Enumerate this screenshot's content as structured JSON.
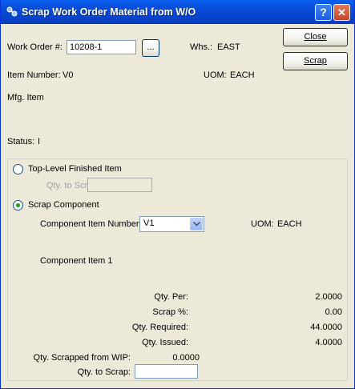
{
  "window": {
    "title": "Scrap Work Order Material from W/O",
    "help_label": "?",
    "close_label": "✕"
  },
  "header": {
    "work_order_label": "Work Order #:",
    "work_order_value": "10208-1",
    "lookup_label": "...",
    "whs_label": "Whs.:",
    "whs_value": "EAST",
    "item_number_label": "Item Number:",
    "item_number_value": "V0",
    "uom_label": "UOM:",
    "uom_value": "EACH",
    "description": "Mfg. Item",
    "status_label": "Status:",
    "status_value": "I"
  },
  "buttons": {
    "close_label": "Close",
    "scrap_label": "Scrap"
  },
  "scrap_type": {
    "top_level_label": "Top-Level Finished Item",
    "top_level_selected": false,
    "qty_to_scrap_label": "Qty. to Scrap:",
    "qty_to_scrap_value": "",
    "component_label": "Scrap Component",
    "component_selected": true
  },
  "component": {
    "item_number_label": "Component Item Number:",
    "item_number_value": "V1",
    "uom_label": "UOM:",
    "uom_value": "EACH",
    "description": "Component Item 1",
    "qty_per_label": "Qty. Per:",
    "qty_per_value": "2.0000",
    "scrap_pct_label": "Scrap %:",
    "scrap_pct_value": "0.00",
    "qty_required_label": "Qty. Required:",
    "qty_required_value": "44.0000",
    "qty_issued_label": "Qty. Issued:",
    "qty_issued_value": "4.0000",
    "qty_scrapped_wip_label": "Qty. Scrapped from WIP:",
    "qty_scrapped_wip_value": "0.0000",
    "qty_to_scrap_label": "Qty. to Scrap:",
    "qty_to_scrap_value": ""
  },
  "colors": {
    "title_bar": "#0a4ad6",
    "window_bg": "#ece9d8",
    "radio_dot": "#21a121"
  }
}
